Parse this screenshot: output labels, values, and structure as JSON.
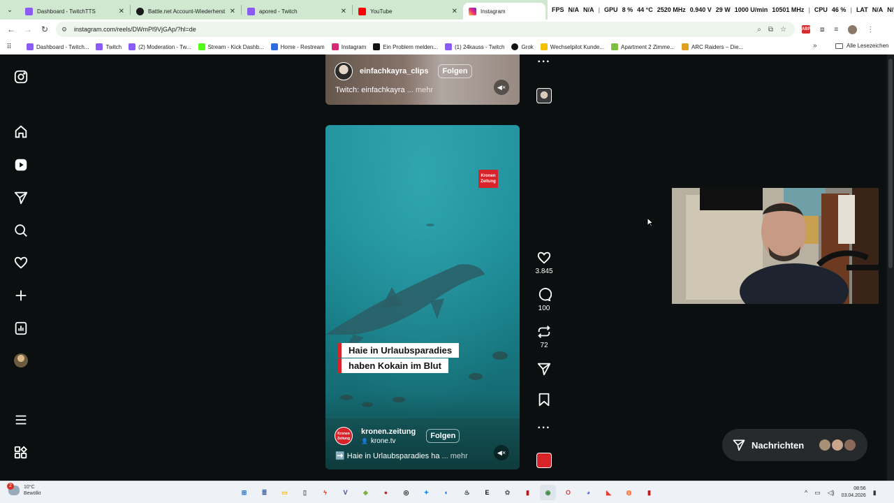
{
  "browser": {
    "tabs": [
      {
        "title": "Dashboard - TwitchTTS",
        "favicon": "twitch-icon",
        "color": "#8a5cf5",
        "active": false
      },
      {
        "title": "Battle.net Account-Wiederherst",
        "favicon": "battlenet-icon",
        "color": "#1a1a1a",
        "active": false
      },
      {
        "title": "apored - Twitch",
        "favicon": "twitch-icon",
        "color": "#8a5cf5",
        "active": false
      },
      {
        "title": "YouTube",
        "favicon": "youtube-icon",
        "color": "#ff0000",
        "active": false
      },
      {
        "title": "Instagram",
        "favicon": "instagram-icon",
        "color": "#d62976",
        "active": true
      }
    ],
    "url": "instagram.com/reels/DWmPl9VjGAp/?hl=de",
    "hud": {
      "fps": "FPS",
      "fps_val": "N/A",
      "fps_val2": "N/A",
      "gpu_label": "GPU",
      "gpu_pct": "8 %",
      "gpu_temp": "44 °C",
      "gpu_clock": "2520 MHz",
      "gpu_volt": "0.940 V",
      "gpu_power": "29 W",
      "gpu_fan": "1000 U/min",
      "gpu_mem": "10501 MHz",
      "cpu_label": "CPU",
      "cpu_pct": "46 %",
      "lat_label": "LAT",
      "lat_val": "N/A",
      "lat_val2": "N/A"
    },
    "bookmarks": [
      {
        "label": "Dashboard - Twitch...",
        "color": "#8a5cf5"
      },
      {
        "label": "Twitch",
        "color": "#8a5cf5"
      },
      {
        "label": "(2) Moderation - Tw...",
        "color": "#8a5cf5"
      },
      {
        "label": "Stream - Kick Dashb...",
        "color": "#53fc18"
      },
      {
        "label": "Home - Restream",
        "color": "#2d6cdf"
      },
      {
        "label": "Instagram",
        "color": "#d62976"
      },
      {
        "label": "Ein Problem melden...",
        "color": "#111111"
      },
      {
        "label": "(1) 24kauss - Twitch",
        "color": "#8a5cf5"
      },
      {
        "label": "Grok",
        "color": "#111111"
      },
      {
        "label": "Wechselpilot Kunde...",
        "color": "#f2c200"
      },
      {
        "label": "Apartment 2 Zimme...",
        "color": "#7fbf3f"
      },
      {
        "label": "ARC Raiders – Die...",
        "color": "#e0a020"
      }
    ],
    "all_bookmarks": "Alle Lesezeichen"
  },
  "reel_top": {
    "username": "einfachkayra_clips",
    "follow": "Folgen",
    "caption": "Twitch: einfachkayra",
    "more": "... mehr"
  },
  "reel_main": {
    "logo_text": "Kronen Zeitung",
    "headline_1": "Haie in Urlaubsparadies",
    "headline_2": "haben Kokain im Blut",
    "username": "kronen.zeitung",
    "sub_user": "krone.tv",
    "follow": "Folgen",
    "caption": "➡️ Haie in Urlaubsparadies ha",
    "more": "... mehr",
    "likes": "3.845",
    "comments": "100",
    "reposts": "72"
  },
  "messages": {
    "label": "Nachrichten"
  },
  "taskbar": {
    "weather_temp": "10°C",
    "weather_desc": "Bewölkt",
    "notification_count": "2",
    "time": "08:56",
    "date": "03.04.2026",
    "apps": [
      {
        "name": "windows-start-icon",
        "color": "#1e6fd9",
        "glyph": "⊞"
      },
      {
        "name": "notes-app-icon",
        "color": "#2b5797",
        "glyph": "≣"
      },
      {
        "name": "file-explorer-icon",
        "color": "#f2b705",
        "glyph": "▭"
      },
      {
        "name": "mouse-app-icon",
        "color": "#555555",
        "glyph": "▯"
      },
      {
        "name": "red-app-icon",
        "color": "#d93025",
        "glyph": "ϟ"
      },
      {
        "name": "v-app-icon",
        "color": "#3949ab",
        "glyph": "V"
      },
      {
        "name": "game-app-icon",
        "color": "#7cb342",
        "glyph": "◆"
      },
      {
        "name": "rec-app-icon",
        "color": "#c62828",
        "glyph": "●"
      },
      {
        "name": "obs-icon",
        "color": "#222222",
        "glyph": "◎"
      },
      {
        "name": "battlenet-icon",
        "color": "#148eff",
        "glyph": "✦"
      },
      {
        "name": "uplay-icon",
        "color": "#1565c0",
        "glyph": "◐"
      },
      {
        "name": "steam-icon",
        "color": "#1b2838",
        "glyph": "♨"
      },
      {
        "name": "epic-games-icon",
        "color": "#111111",
        "glyph": "E"
      },
      {
        "name": "settings-app-icon",
        "color": "#666666",
        "glyph": "✿"
      },
      {
        "name": "stream-app-icon",
        "color": "#b71c1c",
        "glyph": "▮"
      },
      {
        "name": "chrome-icon",
        "color": "#3c8d3f",
        "glyph": "◉"
      },
      {
        "name": "opera-icon",
        "color": "#e53935",
        "glyph": "O"
      },
      {
        "name": "discord-icon",
        "color": "#5865f2",
        "glyph": "◕"
      },
      {
        "name": "red-logo-icon",
        "color": "#e53935",
        "glyph": "◣"
      },
      {
        "name": "firefox-icon",
        "color": "#ff7139",
        "glyph": "◍"
      },
      {
        "name": "stream-app-2-icon",
        "color": "#b71c1c",
        "glyph": "▮"
      }
    ]
  }
}
